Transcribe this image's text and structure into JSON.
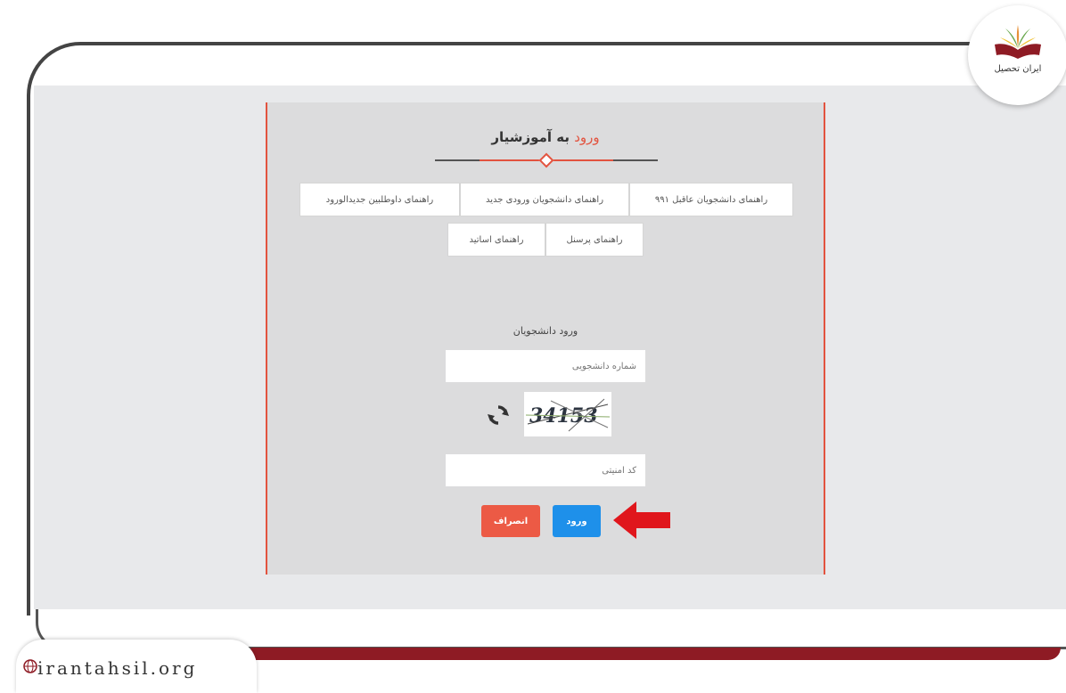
{
  "panel": {
    "title_accent": "ورود",
    "title_rest": " به آموزشیار",
    "guides_row1": [
      "راهنمای دانشجویان عاقبل ۹۹۱",
      "راهنمای دانشجویان ورودی جدید",
      "راهنمای داوطلبین جدیدالورود"
    ],
    "guides_row2": [
      "راهنمای پرسنل",
      "راهنمای اساتید"
    ],
    "section_title": "ورود دانشجویان",
    "student_id_placeholder": "شماره دانشجویی",
    "security_code_placeholder": "کد امنیتی",
    "captcha_text": "34153",
    "login_label": "ورود",
    "cancel_label": "انصراف"
  },
  "branding": {
    "logo_text": "ایران تحصیل",
    "site_url": "irantahsil.org"
  },
  "colors": {
    "accent": "#e2533f",
    "login_button": "#1e90ea",
    "cancel_button": "#ec5a45",
    "arrow": "#e0161c",
    "bottom_bar": "#8e1b24"
  }
}
